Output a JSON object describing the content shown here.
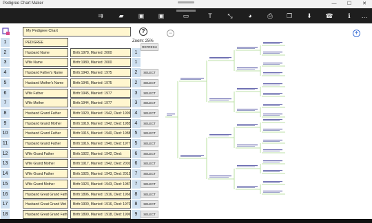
{
  "window": {
    "title": "Pedigree Chart Maker"
  },
  "toolbar": {
    "icons": [
      "open-share-icon",
      "folder-icon",
      "save-icon",
      "save-as-icon",
      "text-icon",
      "resize-icon",
      "palette-icon",
      "print-icon",
      "copy-icon",
      "download-icon",
      "contact-icon",
      "info-icon",
      "more-icon"
    ]
  },
  "chart_title": "My Pedigree Chart",
  "zoom_label": "Zoom: 25%",
  "refresh_label": "REFRESH",
  "select_label": "SELECT",
  "rows": [
    {
      "num": "1",
      "name": "PEDIGREE",
      "info": "",
      "pnum": "1",
      "action": "refresh"
    },
    {
      "num": "2",
      "name": "Husband Name",
      "info": "Birth:1978, Married: 2000",
      "pnum": "1",
      "action": "refresh"
    },
    {
      "num": "3",
      "name": "Wife Name",
      "info": "Birth:1980, Married: 2000",
      "pnum": "1",
      "action": ""
    },
    {
      "num": "4",
      "name": "Husband Father's Name",
      "info": "Birth:1943, Married: 1975",
      "pnum": "2",
      "action": "select"
    },
    {
      "num": "5",
      "name": "Husband Mother's Name",
      "info": "Birth:1945, Married: 1975",
      "pnum": "2",
      "action": "select"
    },
    {
      "num": "6",
      "name": "Wife Father",
      "info": "Birth:1945, Married: 1977",
      "pnum": "3",
      "action": "select"
    },
    {
      "num": "7",
      "name": "Wife Mother",
      "info": "Birth:1944, Married: 1977",
      "pnum": "3",
      "action": "select"
    },
    {
      "num": "8",
      "name": "Husband Grand Father",
      "info": "Birth:1920, Married: 1942, Died: 1999",
      "pnum": "4",
      "action": "select"
    },
    {
      "num": "9",
      "name": "Husband Grand Mother",
      "info": "Birth:1918, Married: 1942, Died: 1985",
      "pnum": "4",
      "action": "select"
    },
    {
      "num": "10",
      "name": "Husband Grand Father",
      "info": "Birth:1915, Married: 1940, Died: 1988",
      "pnum": "5",
      "action": "select"
    },
    {
      "num": "11",
      "name": "Husband Grand Father",
      "info": "Birth:1916, Married: 1940, Died: 1977",
      "pnum": "5",
      "action": "select"
    },
    {
      "num": "12",
      "name": "Wife  Grand Father",
      "info": "Birth:1922, Married: 1942, Died:",
      "pnum": "6",
      "action": "select"
    },
    {
      "num": "13",
      "name": "Wife Grand Mother",
      "info": "Birth:1917, Married: 1942, Died: 2002",
      "pnum": "6",
      "action": "select"
    },
    {
      "num": "14",
      "name": "Wife Grand Father",
      "info": "Birth:1925, Married: 1943, Died: 2015",
      "pnum": "7",
      "action": "select"
    },
    {
      "num": "15",
      "name": "Wife Grand Mother",
      "info": "Birth:1923, Married: 1943, Died: 1987",
      "pnum": "7",
      "action": "select"
    },
    {
      "num": "16",
      "name": "Husband Great Grand Fath",
      "info": "Birth:1896, Married: 1916, Died: 1966",
      "pnum": "8",
      "action": "select"
    },
    {
      "num": "17",
      "name": "Husband Great Grand Mot",
      "info": "Birth:1900, Married: 1916, Died: 1970",
      "pnum": "8",
      "action": "select"
    },
    {
      "num": "18",
      "name": "Husband Great Grand Fath",
      "info": "Birth:1890, Married: 1918, Died: 1996",
      "pnum": "9",
      "action": "select"
    }
  ],
  "tree": {
    "root": "PEDIGREE",
    "title": "My Pedigree Chart"
  },
  "colors": {
    "toolbar_bg": "#1e1e1e",
    "field_bg": "#fff6cf",
    "number_bg": "#cfe0f0",
    "accent": "#5a3fb5",
    "tree_line": "#a8d98a"
  }
}
